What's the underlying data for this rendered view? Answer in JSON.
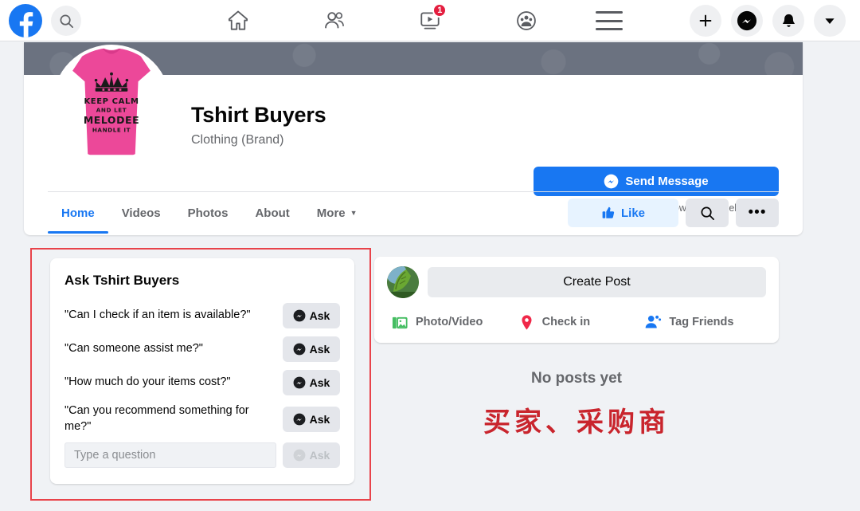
{
  "topbar": {
    "logo": "facebook-logo",
    "search_icon": "search-icon",
    "nav": [
      {
        "name": "home",
        "icon": "home-icon",
        "badge": ""
      },
      {
        "name": "friends",
        "icon": "friends-icon",
        "badge": ""
      },
      {
        "name": "watch",
        "icon": "watch-icon",
        "badge": "1"
      },
      {
        "name": "groups",
        "icon": "groups-icon",
        "badge": ""
      }
    ],
    "menu_icon": "hamburger-menu-icon",
    "right_icons": [
      {
        "name": "create",
        "icon": "plus-icon"
      },
      {
        "name": "messenger",
        "icon": "messenger-icon"
      },
      {
        "name": "notifications",
        "icon": "bell-icon"
      },
      {
        "name": "account",
        "icon": "chevron-down-icon"
      }
    ]
  },
  "profile": {
    "name": "Tshirt Buyers",
    "category": "Clothing (Brand)",
    "avatar_alt": "pink-tshirt-keep-calm-melodee",
    "avatar_shirt_lines": [
      "KEEP CALM",
      "AND LET",
      "MELODEE",
      "HANDLE IT"
    ],
    "send_message_label": "Send Message",
    "message_note": "Hi! Please let us know how we can help."
  },
  "tabs": [
    {
      "label": "Home",
      "active": true
    },
    {
      "label": "Videos",
      "active": false
    },
    {
      "label": "Photos",
      "active": false
    },
    {
      "label": "About",
      "active": false
    },
    {
      "label": "More",
      "active": false,
      "caret": "▼"
    }
  ],
  "tab_actions": {
    "like_label": "Like",
    "search_icon": "search-icon",
    "more_icon": "ellipsis-icon"
  },
  "ask_panel": {
    "title": "Ask Tshirt Buyers",
    "questions": [
      "\"Can I check if an item is available?\"",
      "\"Can someone assist me?\"",
      "\"How much do your items cost?\"",
      "\"Can you recommend something for me?\""
    ],
    "ask_label": "Ask",
    "input_placeholder": "Type a question",
    "input_value": "",
    "disabled_ask_label": "Ask"
  },
  "create_post": {
    "placeholder": "Create Post",
    "avatar_alt": "green-leaf-avatar",
    "actions": [
      {
        "label": "Photo/Video",
        "icon": "photo-video-icon",
        "color": "#45bd62"
      },
      {
        "label": "Check in",
        "icon": "location-pin-icon",
        "color": "#f02849"
      },
      {
        "label": "Tag Friends",
        "icon": "tag-friends-icon",
        "color": "#1877f2"
      }
    ]
  },
  "feed": {
    "empty_label": "No posts yet",
    "annotation_text": "买家、采购商",
    "annotation_color": "#c9252d"
  },
  "annotation": {
    "box_color": "#e8434a"
  }
}
